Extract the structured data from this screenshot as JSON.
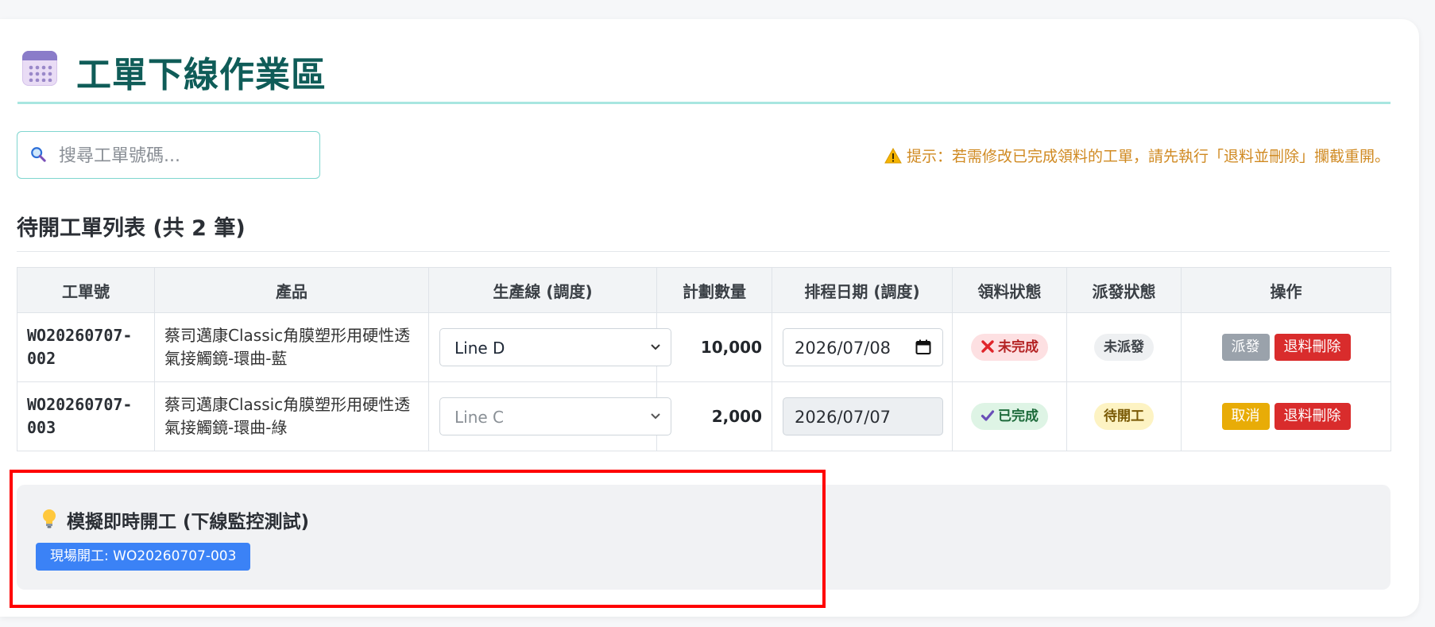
{
  "header": {
    "title": "工單下線作業區",
    "icon": "calendar-icon"
  },
  "search": {
    "placeholder": "搜尋工單號碼...",
    "value": ""
  },
  "hint": {
    "text": "提示：若需修改已完成領料的工單，請先執行「退料並刪除」攔截重開。",
    "color": "#d08a22"
  },
  "list": {
    "title": "待開工單列表 (共 2 筆)",
    "columns": [
      "工單號",
      "產品",
      "生產線 (調度)",
      "計劃數量",
      "排程日期 (調度)",
      "領料狀態",
      "派發狀態",
      "操作"
    ],
    "rows": [
      {
        "wo_line1": "WO20260707-",
        "wo_line2": "002",
        "product_line1": "蔡司邁康Classic角膜塑形用硬性透",
        "product_line2": "氣接觸鏡-環曲-藍",
        "line": "Line D",
        "qty": "10,000",
        "date": "2026/07/08",
        "material_status": "未完成",
        "dispatch_status": "未派發",
        "action_primary": "派發",
        "action_delete": "退料刪除"
      },
      {
        "wo_line1": "WO20260707-",
        "wo_line2": "003",
        "product_line1": "蔡司邁康Classic角膜塑形用硬性透",
        "product_line2": "氣接觸鏡-環曲-綠",
        "line": "Line C",
        "qty": "2,000",
        "date": "2026/07/07",
        "material_status": "已完成",
        "dispatch_status": "待開工",
        "action_primary": "取消",
        "action_delete": "退料刪除"
      }
    ]
  },
  "simulation": {
    "title": "模擬即時開工 (下線監控測試)",
    "button": "現場開工: WO20260707-003"
  },
  "colors": {
    "accent": "#0f5c58",
    "primary": "#3b82f6",
    "danger": "#d92c2c",
    "warning": "#e8ac07",
    "highlight": "#ff0000"
  }
}
